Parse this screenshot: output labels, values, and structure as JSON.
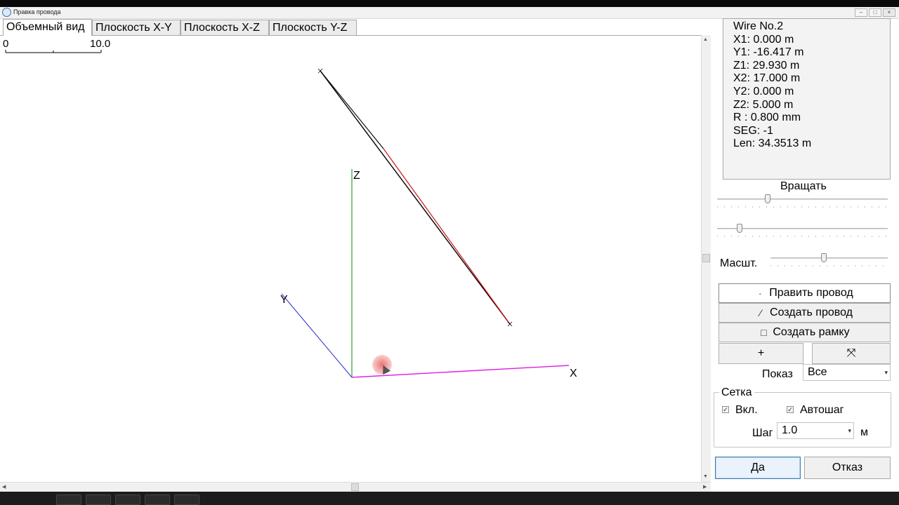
{
  "tabs": [
    "Объемный вид",
    "Плоскость X-Y",
    "Плоскость X-Z",
    "Плоскость Y-Z"
  ],
  "scale_bar": {
    "min_label": "0",
    "max_label": "10.0"
  },
  "axes": {
    "z": "Z",
    "y": "Y",
    "x": "X"
  },
  "axis_colors": {
    "x": "#e020e0",
    "y": "#2b2bd0",
    "z": "#30a030",
    "wire": "#000000",
    "wire_highlight": "#d01010"
  },
  "wire_info": [
    "Wire No.2",
    "X1: 0.000 m",
    "Y1: -16.417 m",
    "Z1: 29.930 m",
    "X2: 17.000 m",
    "Y2: 0.000 m",
    "Z2: 5.000 m",
    "R : 0.800 mm",
    "SEG: -1",
    "Len: 34.3513 m"
  ],
  "controls": {
    "rotate_label": "Вращать",
    "scale_label": "Масшт.",
    "rotate_h_level": 0.29,
    "rotate_v_level": 0.12,
    "scale_level": 0.45
  },
  "tools": {
    "edit_wire": "Править провод",
    "create_wire": "Создать провод",
    "create_frame": "Создать рамку",
    "edit_wire_icon": "dot-icon",
    "create_wire_icon": "line-icon",
    "create_frame_icon": "square-icon",
    "plus_label": "+",
    "fit_label": "⤧"
  },
  "show": {
    "label": "Показ",
    "value": "Все"
  },
  "grid": {
    "title": "Сетка",
    "enabled_label": "Вкл.",
    "enabled": true,
    "autostep_label": "Автошаг",
    "autostep": true,
    "step_label": "Шаг",
    "step_value": "1.0",
    "unit": "м"
  },
  "buttons": {
    "ok": "Да",
    "cancel": "Отказ"
  }
}
